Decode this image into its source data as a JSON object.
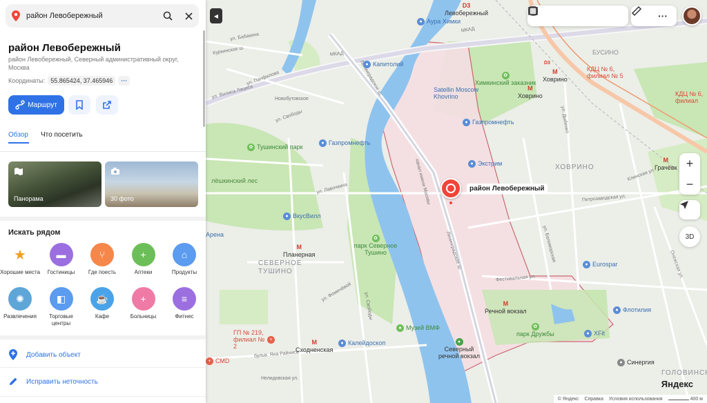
{
  "search": {
    "value": "район Левобережный",
    "placeholder": ""
  },
  "place": {
    "title": "район Левобережный",
    "subtitle": "район Левобережный, Северный административный округ, Москва",
    "coords_label": "Координаты:",
    "coords_value": "55.865424, 37.465946",
    "coords_more": "···"
  },
  "buttons": {
    "route": "Маршрут"
  },
  "tabs": [
    "Обзор",
    "Что посетить"
  ],
  "photos": [
    {
      "label": "Панорама",
      "icon": "panorama-icon"
    },
    {
      "label": "30 фото",
      "icon": "camera-icon"
    }
  ],
  "nearby": {
    "title": "Искать рядом",
    "categories": [
      {
        "label": "Хорошие места",
        "icon": "award-icon",
        "color": "#ffffff"
      },
      {
        "label": "Гостиницы",
        "icon": "bed-icon",
        "color": "#9b6fe0"
      },
      {
        "label": "Где поесть",
        "icon": "cutlery-icon",
        "color": "#f5874a"
      },
      {
        "label": "Аптеки",
        "icon": "plus-icon",
        "color": "#6cbf58"
      },
      {
        "label": "Продукты",
        "icon": "basket-icon",
        "color": "#5b9bf0"
      },
      {
        "label": "Развлечения",
        "icon": "ferris-wheel-icon",
        "color": "#5ea6d8"
      },
      {
        "label": "Торговые центры",
        "icon": "shopping-bag-icon",
        "color": "#5b9bf0"
      },
      {
        "label": "Кафе",
        "icon": "coffee-cup-icon",
        "color": "#4aa3e8"
      },
      {
        "label": "Больницы",
        "icon": "cross-icon",
        "color": "#f07aa6"
      },
      {
        "label": "Фитнес",
        "icon": "dumbbell-icon",
        "color": "#9b6fe0"
      }
    ]
  },
  "actions": {
    "add_object": "Добавить объект",
    "fix_error": "Исправить неточность"
  },
  "map": {
    "place_label": "район Левобережный",
    "districts": [
      "ХОВРИНО",
      "СЕВЕРНОЕ ТУШИНО",
      "ГОЛОВИНСКИЙ"
    ],
    "labels": {
      "tushino_park": "Тушинский парк",
      "leshkinsky": "лёшкинский лес",
      "arena": "Арена",
      "vkusvill": "ВкусВилл",
      "planernaya": "Планерная",
      "park_sev_tushino": "парк Северное Тушино",
      "muzey_vmf": "Музей ВМФ",
      "kaleidoskop": "Калейдоскоп",
      "skhodnenskaya": "Сходненская",
      "gp219": "ГП № 219, филиал № 2",
      "smd": "СМD",
      "sev_rech_vokzal": "Северный речной вокзал",
      "rech_vokzal": "Речной вокзал",
      "park_druzhby": "парк Дружбы",
      "xfit": "XFit",
      "sinergiya": "Синергия",
      "flotiliya": "Флотилия",
      "eurospar": "Eurospar",
      "extrim": "Экстрим",
      "gazpromneft1": "Газпромнефть",
      "gazpromneft2": "Газпромнефть",
      "satellin": "Satellin Moscow Khovrino",
      "khimkinsky": "Химкинский заказник",
      "khovrino_metro": "Ховрино",
      "khovrino_station": "Ховрино",
      "kapitoliy": "Капитолий",
      "aura": "Аура Химки",
      "levoberezhny_st": "Левобережный",
      "busino": "БУСИНО",
      "kdc6": "КДЦ № 6, филиал № 5",
      "kdc6b": "КДЦ № 6, филиал",
      "grachevka": "Грачёвк",
      "d3a": "D3",
      "d3b": "D3",
      "mkad": "МКАД",
      "mkad2": "МКАД",
      "leningradskoe": "Ленинградское ш.",
      "leningradskoe2": "Ленинградское ш.",
      "kanal": "канал имени Москвы",
      "ul_svobody": "ул. Свободы",
      "ul_svobody2": "ул. Свободы",
      "fomichevoy": "ул. Фомичёвой",
      "festivalnaya": "Фестивальная ул.",
      "petrozavodskaya": "Петрозаводская ул.",
      "dybenko": "ул. Дыбенко",
      "beloretskaya": "ул. Беломорская",
      "nelidovskaya": "Нелидовская ул.",
      "yana_raynisa": "бульв. Яна Райниса",
      "babakina": "ул. Бабакина",
      "kurkinskoe": "Куркинское ш.",
      "vilisa_latsisa": "ул. Вилиса Лациса",
      "panfilova": "ул. Панфилова",
      "novoshosse": "Новобутовское",
      "novo_tushinskaya": "Новотушинская",
      "lavochkina": "ул. Лавочкина",
      "kronstadt": "Кронштадтский",
      "onezhskaya": "Онежская ул.",
      "klinskaya": "Клинская ул."
    },
    "controls": {
      "zoom_in": "+",
      "zoom_out": "−",
      "mode_3d": "3D"
    },
    "logo": "Яндекс",
    "footer": [
      "© Яндекс",
      "Справка",
      "Условия использования"
    ],
    "scale": "400 м"
  },
  "colors": {
    "accent": "#2f72e6",
    "pin": "#f0463a",
    "water": "#8ec3ee",
    "park": "#c9e6b5",
    "boundary": "#c65a63",
    "district_fill": "#f5dfe3"
  }
}
